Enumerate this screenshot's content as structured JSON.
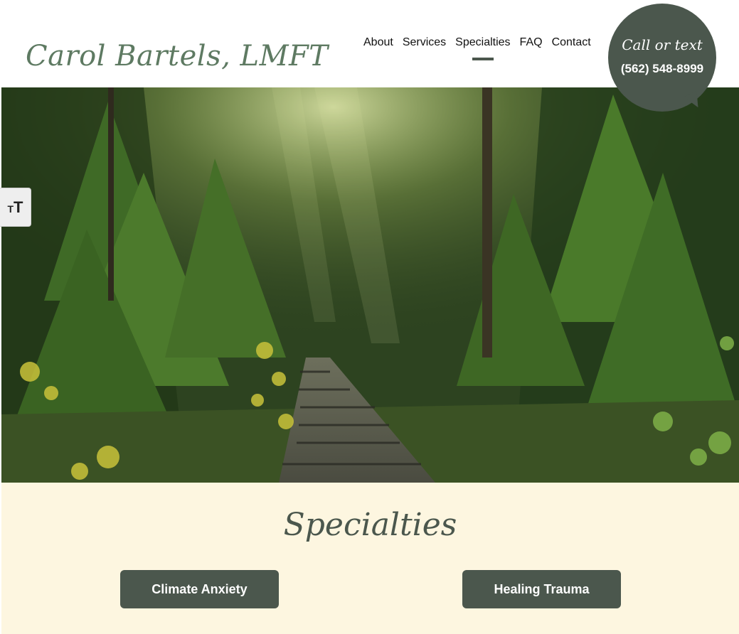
{
  "header": {
    "logo_text": "Carol Bartels, LMFT",
    "nav": [
      {
        "label": "About"
      },
      {
        "label": "Services"
      },
      {
        "label": "Specialties",
        "active": true
      },
      {
        "label": "FAQ"
      },
      {
        "label": "Contact"
      }
    ],
    "call": {
      "label": "Call or text",
      "phone": "(562) 548-8999"
    }
  },
  "accessibility": {
    "font_size_icon": "text-size-icon",
    "small_glyph": "T",
    "large_glyph": "T"
  },
  "hero": {
    "image": "forest-path-photo"
  },
  "specialties": {
    "title": "Specialties",
    "buttons": [
      {
        "label": "Climate Anxiety"
      },
      {
        "label": "Healing Trauma"
      }
    ]
  },
  "colors": {
    "brand_green": "#4b574d",
    "logo_green": "#5e7a62",
    "cream": "#fdf6e0"
  }
}
